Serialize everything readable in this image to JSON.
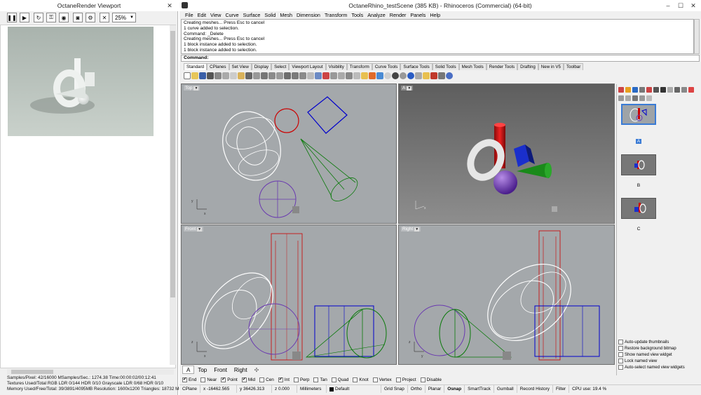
{
  "octane": {
    "title": "OctaneRender Viewport",
    "zoom": "25%",
    "controls": [
      "pause",
      "play",
      "restart",
      "lock",
      "region",
      "screenshot",
      "mode",
      "stop"
    ],
    "stats": [
      "Samples/Pixel: 42/16000   MSamples/Sec.: 1274.38   Time:00:00:02/00:12:41",
      "Textures Used/Total RGB LDR 0/144   HDR 0/10   Grayscale LDR 0/68   HDR 0/10",
      "Memory Used/Free/Total: 39/3891/4095MB   Resolution: 1600x1200   Triangles: 18732   Meshes:"
    ]
  },
  "rhino": {
    "title": "OctaneRhino_testScene (385 KB) - Rhinoceros (Commercial) (64-bit)",
    "menu": [
      "File",
      "Edit",
      "View",
      "Curve",
      "Surface",
      "Solid",
      "Mesh",
      "Dimension",
      "Transform",
      "Tools",
      "Analyze",
      "Render",
      "Panels",
      "Help"
    ],
    "history": [
      "Creating meshes... Press Esc to cancel",
      "1 curve added to selection.",
      "Command: _Delete",
      "Creating meshes... Press Esc to cancel",
      "1 block instance added to selection.",
      "1 block instance added to selection."
    ],
    "command_label": "Command:",
    "tabs": [
      "Standard",
      "CPlanes",
      "Set View",
      "Display",
      "Select",
      "Viewport Layout",
      "Visibility",
      "Transform",
      "Curve Tools",
      "Surface Tools",
      "Solid Tools",
      "Mesh Tools",
      "Render Tools",
      "Drafting",
      "New in V5",
      "Toolbar"
    ],
    "viewports": {
      "top": "Top",
      "perspective": "A",
      "front": "Front",
      "right": "Right"
    },
    "viewport_tabs": [
      "A",
      "Top",
      "Front",
      "Right"
    ],
    "osnaps": [
      {
        "label": "End",
        "checked": true
      },
      {
        "label": "Near",
        "checked": false
      },
      {
        "label": "Point",
        "checked": true
      },
      {
        "label": "Mid",
        "checked": true
      },
      {
        "label": "Cen",
        "checked": false
      },
      {
        "label": "Int",
        "checked": true
      },
      {
        "label": "Perp",
        "checked": false
      },
      {
        "label": "Tan",
        "checked": false
      },
      {
        "label": "Quad",
        "checked": false
      },
      {
        "label": "Knot",
        "checked": false
      },
      {
        "label": "Vertex",
        "checked": false
      },
      {
        "label": "Project",
        "checked": false
      },
      {
        "label": "Disable",
        "checked": false
      }
    ],
    "status": {
      "cplane": "CPlane",
      "x": "x -16462.565",
      "y": "y 36426.313",
      "z": "z 0.000",
      "units": "Millimeters",
      "layer": "Default",
      "grid_snap": "Grid Snap",
      "ortho": "Ortho",
      "planar": "Planar",
      "osnap": "Osnap",
      "smarttrack": "SmartTrack",
      "gumball": "Gumball",
      "record": "Record History",
      "filter": "Filter",
      "cpu": "CPU use: 19.4 %"
    },
    "named_views": [
      {
        "label": "A"
      },
      {
        "label": "B"
      },
      {
        "label": "C"
      }
    ],
    "named_view_options": [
      "Auto-update thumbnails",
      "Restore background bitmap",
      "Show named view widget",
      "Lock named view",
      "Auto-select named view widgets"
    ]
  }
}
